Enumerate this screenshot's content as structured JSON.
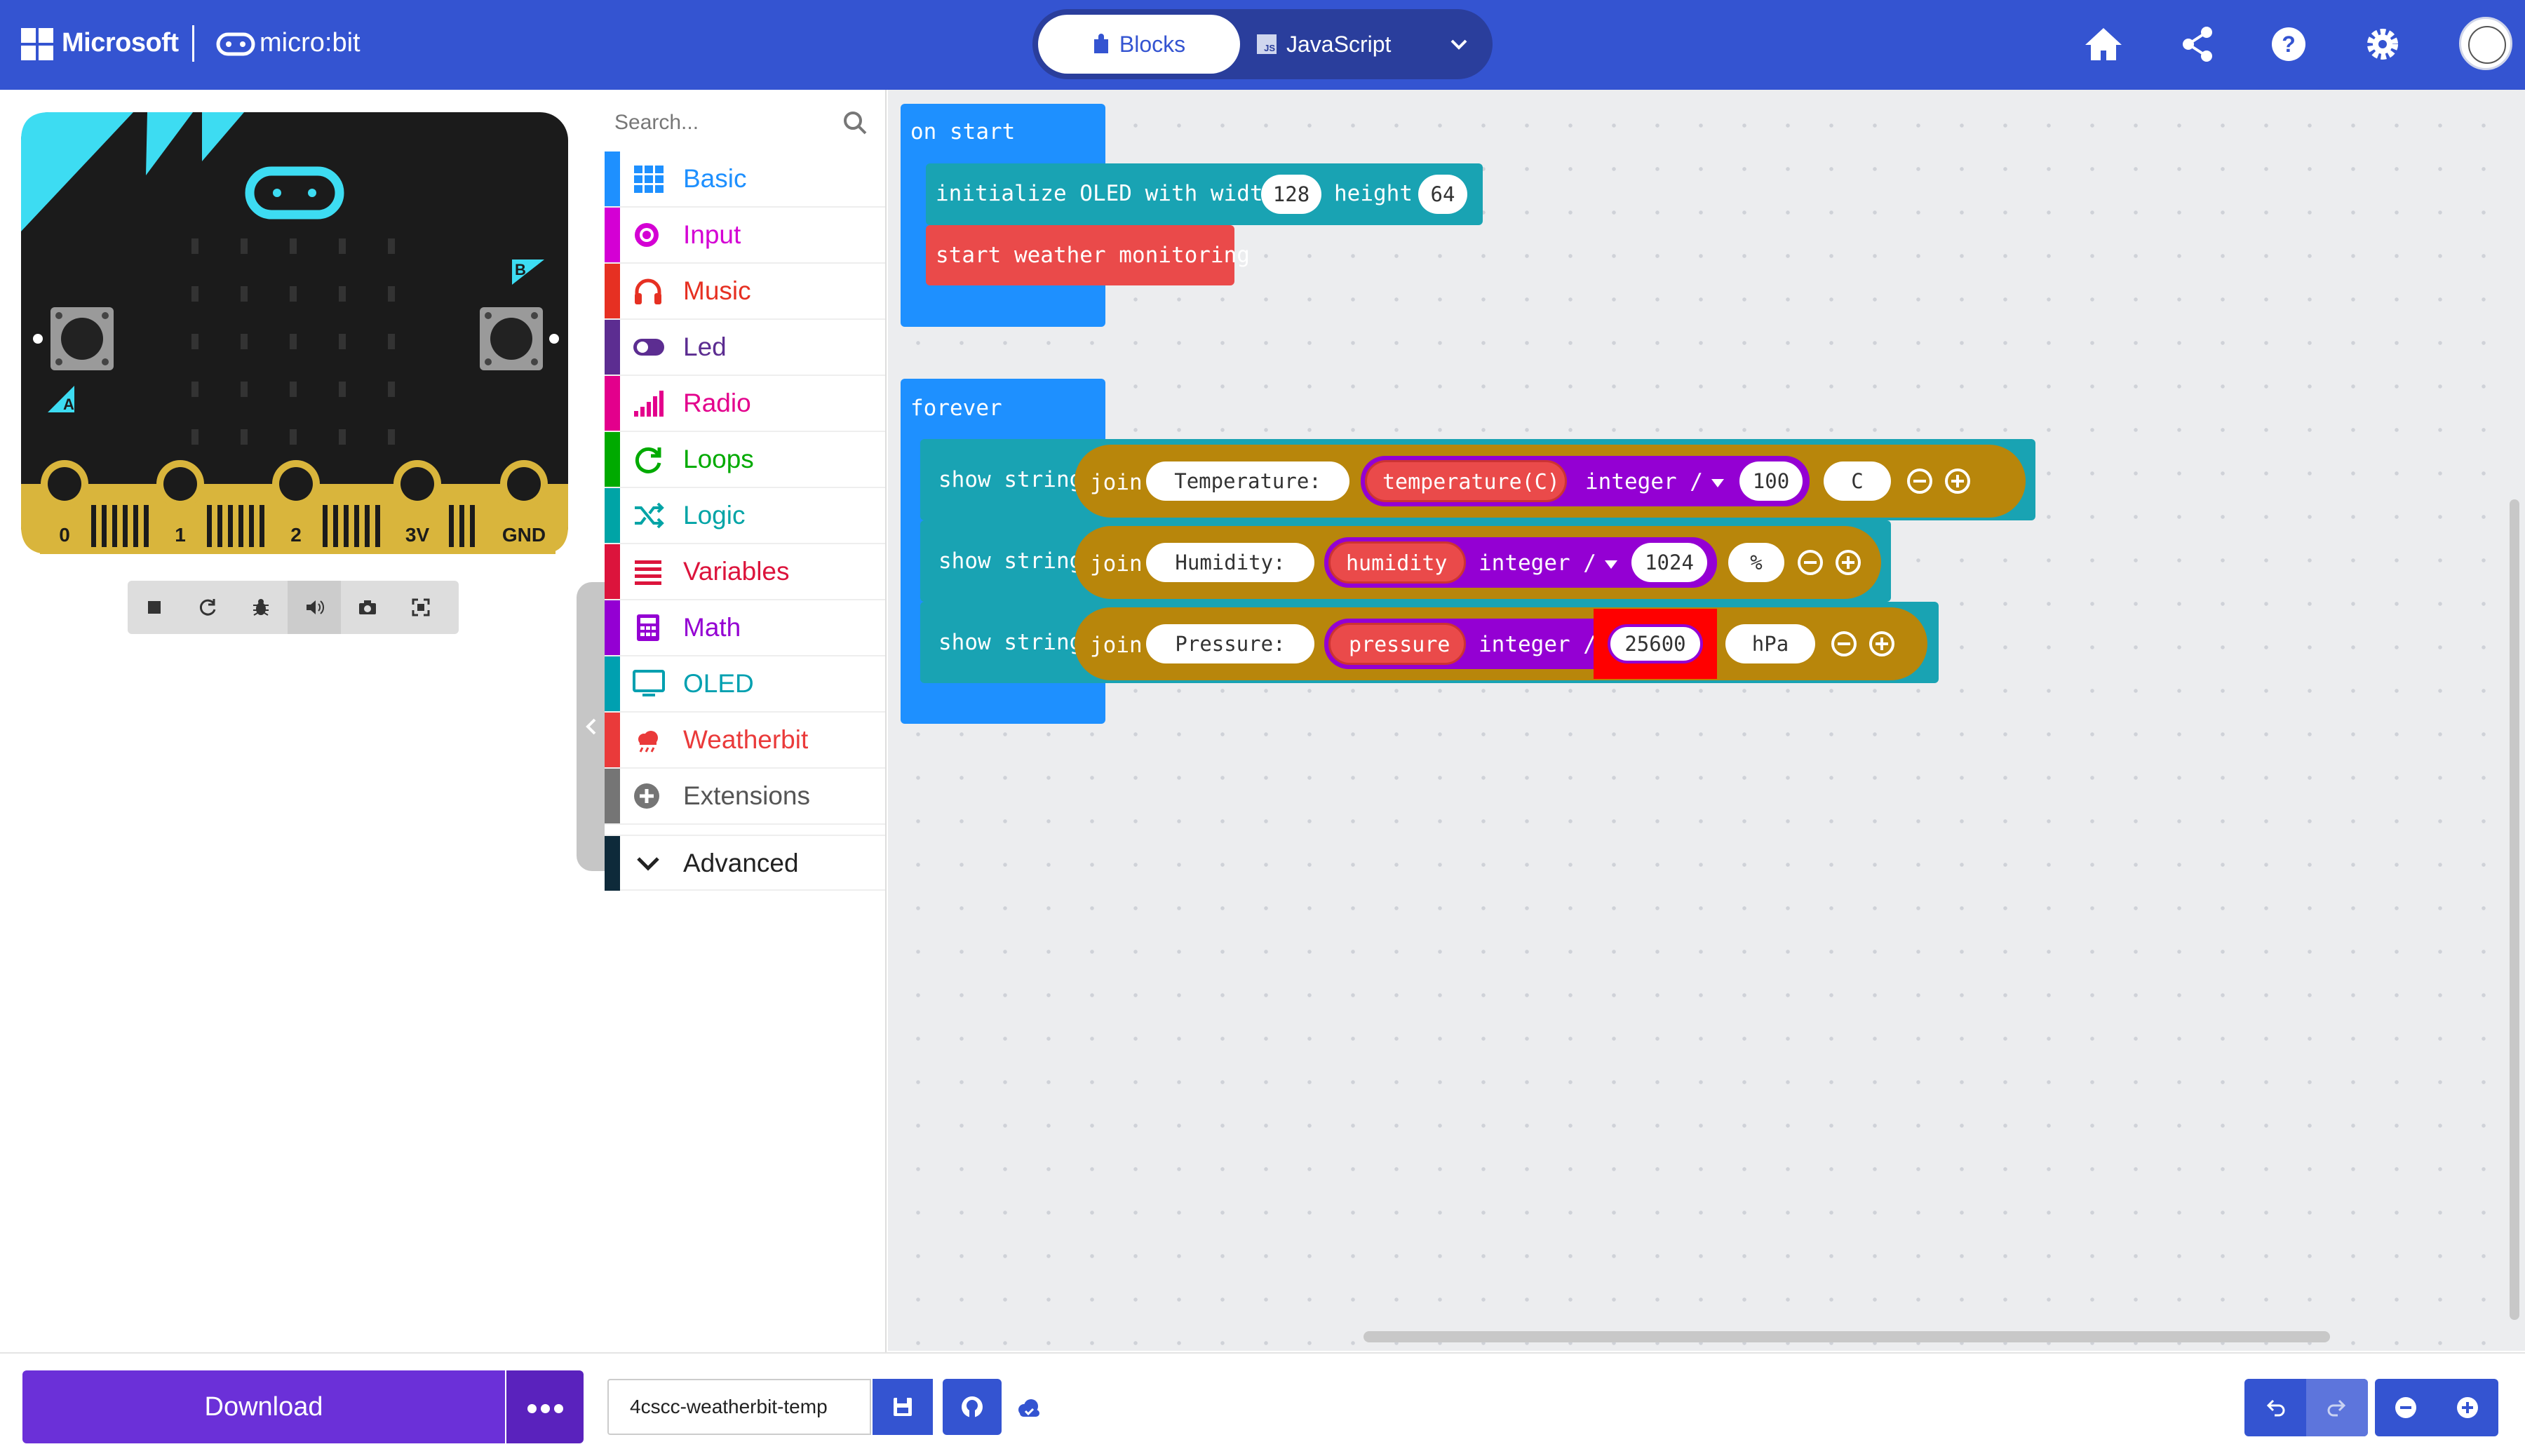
{
  "header": {
    "brand": "Microsoft",
    "product": "micro:bit",
    "tabs": {
      "blocks": "Blocks",
      "javascript": "JavaScript",
      "js_badge": "JS"
    },
    "icons": [
      "home-icon",
      "share-icon",
      "help-icon",
      "settings-icon",
      "user-avatar"
    ],
    "colors": {
      "bar": "#3454d1"
    }
  },
  "simulator": {
    "pins": [
      "0",
      "1",
      "2",
      "3V",
      "GND"
    ],
    "buttons": {
      "a": "A",
      "b": "B"
    },
    "toolbar_icons": [
      "stop-icon",
      "restart-icon",
      "debug-icon",
      "sound-icon",
      "screenshot-icon",
      "fullscreen-icon"
    ]
  },
  "toolbox": {
    "search_placeholder": "Search...",
    "categories": [
      {
        "label": "Basic",
        "color": "#1e90ff",
        "icon": "grid-icon"
      },
      {
        "label": "Input",
        "color": "#d400d4",
        "icon": "target-icon"
      },
      {
        "label": "Music",
        "color": "#e63022",
        "icon": "headphones-icon"
      },
      {
        "label": "Led",
        "color": "#5c2d91",
        "icon": "toggle-icon"
      },
      {
        "label": "Radio",
        "color": "#e3008c",
        "icon": "signal-icon"
      },
      {
        "label": "Loops",
        "color": "#00aa00",
        "icon": "loop-icon"
      },
      {
        "label": "Logic",
        "color": "#00a4a6",
        "icon": "shuffle-icon"
      },
      {
        "label": "Variables",
        "color": "#dc143c",
        "icon": "lines-icon"
      },
      {
        "label": "Math",
        "color": "#9400d3",
        "icon": "calculator-icon"
      },
      {
        "label": "OLED",
        "color": "#00a0b0",
        "icon": "monitor-icon"
      },
      {
        "label": "Weatherbit",
        "color": "#ea3a3a",
        "icon": "weather-icon"
      },
      {
        "label": "Extensions",
        "color": "#757575",
        "icon": "plus-circle-icon"
      }
    ],
    "advanced": {
      "label": "Advanced",
      "color": "#0e2a3a"
    }
  },
  "workspace": {
    "on_start": {
      "hat": "on start",
      "init": {
        "label": "initialize OLED with width",
        "width": "128",
        "height_label": "height",
        "height": "64"
      },
      "start_label": "start weather monitoring"
    },
    "forever": {
      "hat": "forever",
      "rows": [
        {
          "show": "show string",
          "join": "join",
          "text": "Temperature: ",
          "sensor": "temperature(C)",
          "op": "integer /",
          "divisor": "100",
          "unit": " C"
        },
        {
          "show": "show string",
          "join": "join",
          "text": "Humidity: ",
          "sensor": "humidity",
          "op": "integer /",
          "divisor": "1024",
          "unit": "%"
        },
        {
          "show": "show string",
          "join": "join",
          "text": "Pressure: ",
          "sensor": "pressure",
          "op": "integer /",
          "divisor": "25600",
          "unit": " hPa"
        }
      ]
    },
    "colors": {
      "events": "#1e90ff",
      "oled": "#19a3b3",
      "weather": "#ea4a4a",
      "join": "#b8860b",
      "math": "#9400d3",
      "highlight": "#ff0000"
    }
  },
  "footer": {
    "download": "Download",
    "project_name": "4cscc-weatherbit-temp",
    "icons": [
      "save-icon",
      "github-icon",
      "cloud-icon",
      "undo-icon",
      "redo-icon",
      "zoom-out-icon",
      "zoom-in-icon"
    ]
  }
}
